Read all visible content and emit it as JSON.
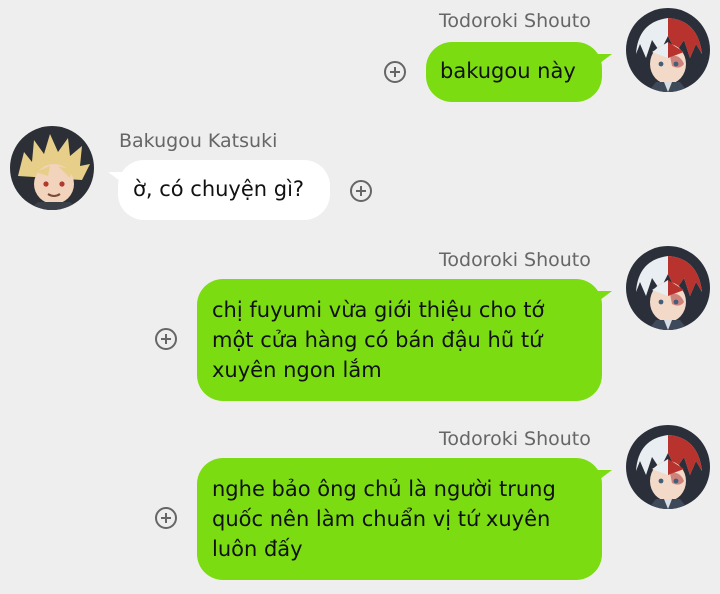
{
  "messages": [
    {
      "sender": "Todoroki Shouto",
      "text": "bakugou này",
      "direction": "outgoing"
    },
    {
      "sender": "Bakugou Katsuki",
      "text": "ờ, có chuyện gì?",
      "direction": "incoming"
    },
    {
      "sender": "Todoroki Shouto",
      "text": "chị fuyumi vừa giới thiệu cho tớ\nmột cửa hàng có bán đậu hũ tứ\nxuyên ngon lắm",
      "direction": "outgoing"
    },
    {
      "sender": "Todoroki Shouto",
      "text": "nghe bảo ông chủ là người trung\nquốc nên làm chuẩn vị tứ xuyên\nluôn đấy",
      "direction": "outgoing"
    }
  ],
  "colors": {
    "outgoing_bubble": "#7bdc11",
    "incoming_bubble": "#ffffff",
    "background": "#eeeeee"
  },
  "icons": {
    "message_action": "plus-circle-icon"
  }
}
